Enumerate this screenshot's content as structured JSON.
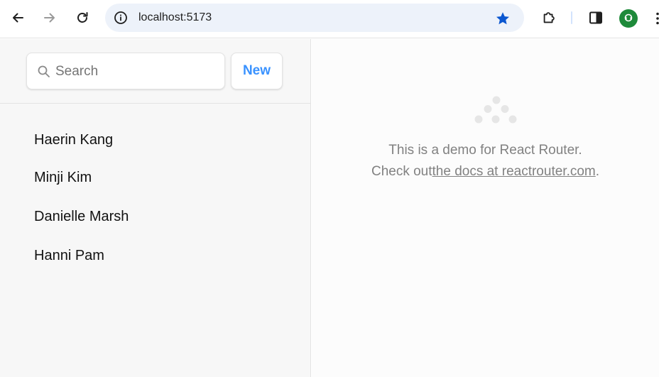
{
  "browser": {
    "url": "localhost:5173",
    "back_icon": "arrow-left-icon",
    "forward_icon": "arrow-right-icon",
    "reload_icon": "reload-icon",
    "site_info_icon": "info-circle-icon",
    "bookmark_icon": "star-filled-icon",
    "extensions_icon": "puzzle-icon",
    "side_panel_icon": "side-panel-icon",
    "profile_icon": "avatar-icon",
    "accent_color": "#0b57d0",
    "profile_color": "#1e8a3a"
  },
  "sidebar": {
    "search": {
      "placeholder": "Search",
      "value": ""
    },
    "new_label": "New",
    "contacts": [
      {
        "name": "Haerin Kang"
      },
      {
        "name": "Minji Kim"
      },
      {
        "name": "Danielle Marsh"
      },
      {
        "name": "Hanni Pam"
      }
    ]
  },
  "detail": {
    "line1": "This is a demo for React Router.",
    "line2_prefix": "Check out",
    "docs_link": "the docs at reactrouter.com",
    "line2_suffix": "."
  },
  "theme": {
    "link_blue": "#3992ff",
    "muted_text": "#818181"
  }
}
